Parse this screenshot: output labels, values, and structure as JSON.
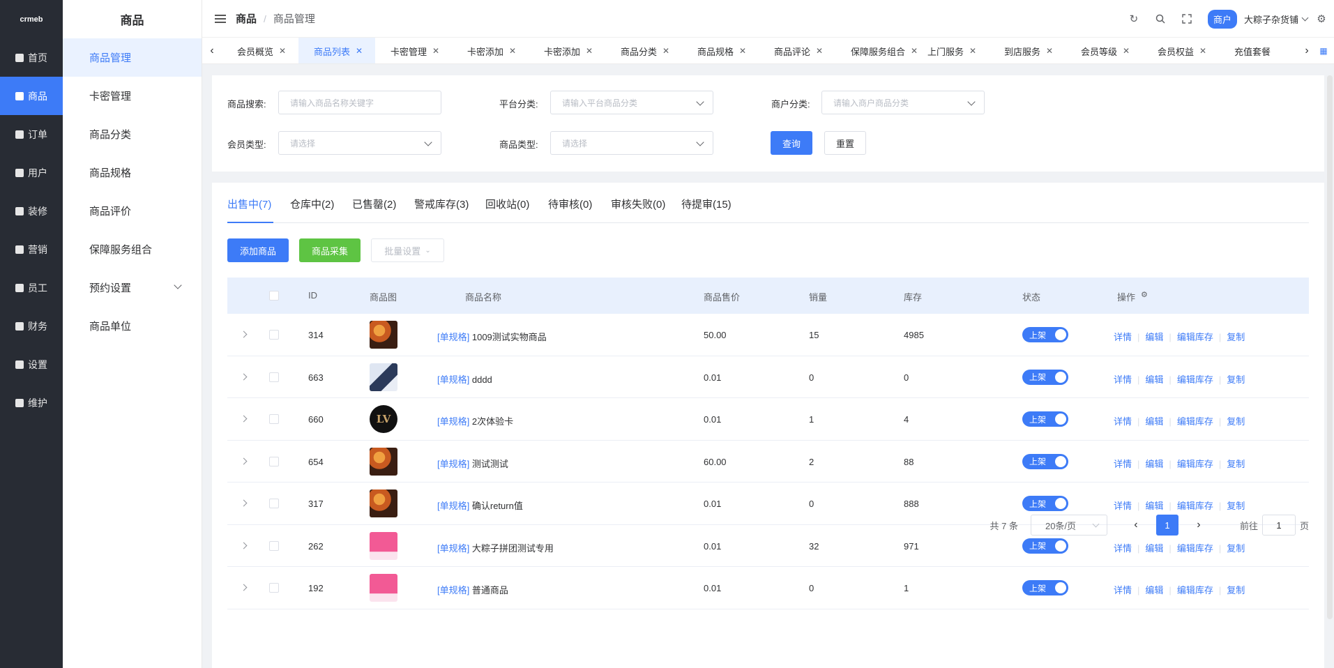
{
  "rail": {
    "logo": "crmeb",
    "items": [
      {
        "label": "首页",
        "icon": "grid-icon"
      },
      {
        "label": "商品",
        "icon": "bag-icon"
      },
      {
        "label": "订单",
        "icon": "doc-icon"
      },
      {
        "label": "用户",
        "icon": "user-icon"
      },
      {
        "label": "装修",
        "icon": "sliders-icon"
      },
      {
        "label": "营销",
        "icon": "card-icon"
      },
      {
        "label": "员工",
        "icon": "staff-icon"
      },
      {
        "label": "财务",
        "icon": "wallet-icon"
      },
      {
        "label": "设置",
        "icon": "gear-icon"
      },
      {
        "label": "维护",
        "icon": "plus-circle-icon"
      }
    ]
  },
  "subnav": {
    "title": "商品",
    "items": [
      "商品管理",
      "卡密管理",
      "商品分类",
      "商品规格",
      "商品评价",
      "保障服务组合",
      "预约设置",
      "商品单位"
    ]
  },
  "header": {
    "crumb_root": "商品",
    "crumb_sep": "/",
    "crumb_current": "商品管理",
    "merchant_badge": "商户",
    "shop_name": "大粽子杂货铺"
  },
  "tabs": [
    "会员概览",
    "商品列表",
    "卡密管理",
    "卡密添加",
    "卡密添加",
    "商品分类",
    "商品规格",
    "商品评论",
    "保障服务组合",
    "上门服务",
    "到店服务",
    "会员等级",
    "会员权益",
    "充值套餐"
  ],
  "filters": {
    "search_label": "商品搜索:",
    "search_placeholder": "请输入商品名称关键字",
    "platform_label": "平台分类:",
    "platform_placeholder": "请输入平台商品分类",
    "merchant_label": "商户分类:",
    "merchant_placeholder": "请输入商户商品分类",
    "member_label": "会员类型:",
    "member_placeholder": "请选择",
    "type_label": "商品类型:",
    "type_placeholder": "请选择",
    "query_btn": "查询",
    "reset_btn": "重置"
  },
  "status_tabs": [
    "出售中(7)",
    "仓库中(2)",
    "已售罄(2)",
    "警戒库存(3)",
    "回收站(0)",
    "待审核(0)",
    "审核失败(0)",
    "待提审(15)"
  ],
  "actions": {
    "add": "添加商品",
    "collect": "商品采集",
    "batch": "批量设置"
  },
  "table": {
    "headers": [
      "ID",
      "商品图",
      "商品名称",
      "商品售价",
      "销量",
      "库存",
      "状态",
      "操作"
    ],
    "rows": [
      {
        "id": "314",
        "tag": "[单规格]",
        "name": "1009测试实物商品",
        "price": "50.00",
        "sales": "15",
        "stock": "4985",
        "status": "上架",
        "img": "food"
      },
      {
        "id": "663",
        "tag": "[单规格]",
        "name": "dddd",
        "price": "0.01",
        "sales": "0",
        "stock": "0",
        "status": "上架",
        "img": "person"
      },
      {
        "id": "660",
        "tag": "[单规格]",
        "name": "2次体验卡",
        "price": "0.01",
        "sales": "1",
        "stock": "4",
        "status": "上架",
        "img": "lv"
      },
      {
        "id": "654",
        "tag": "[单规格]",
        "name": "测试测试",
        "price": "60.00",
        "sales": "2",
        "stock": "88",
        "status": "上架",
        "img": "food"
      },
      {
        "id": "317",
        "tag": "[单规格]",
        "name": "确认return值",
        "price": "0.01",
        "sales": "0",
        "stock": "888",
        "status": "上架",
        "img": "food"
      },
      {
        "id": "262",
        "tag": "[单规格]",
        "name": "大粽子拼团测试专用",
        "price": "0.01",
        "sales": "32",
        "stock": "971",
        "status": "上架",
        "img": "pink"
      },
      {
        "id": "192",
        "tag": "[单规格]",
        "name": "普通商品",
        "price": "0.01",
        "sales": "0",
        "stock": "1",
        "status": "上架",
        "img": "pink"
      }
    ],
    "ops": [
      "详情",
      "编辑",
      "编辑库存",
      "复制"
    ]
  },
  "pagination": {
    "total": "共 7 条",
    "page_size": "20条/页",
    "current": "1",
    "goto_label": "前往",
    "goto_value": "1",
    "page_suffix": "页"
  },
  "colors": {
    "primary": "#3d7bf7",
    "rail_bg": "#282c34",
    "success": "#5ec443"
  }
}
